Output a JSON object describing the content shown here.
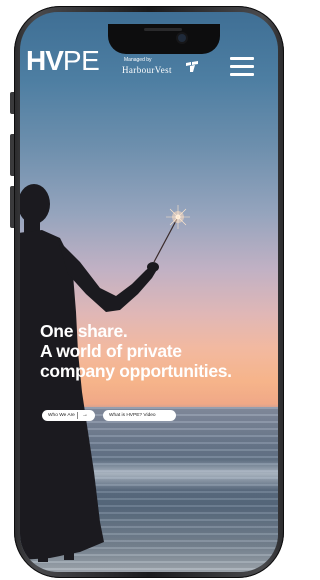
{
  "header": {
    "logo_hv": "HV",
    "logo_pe": "PE",
    "managed_by": "Managed by",
    "brand": "HarbourVest"
  },
  "hero": {
    "headline_lines": [
      "One share.",
      "A world of private",
      "company opportunities."
    ]
  },
  "actions": {
    "who_we_are": "Who We Are",
    "who_we_are_arrow": "→",
    "video": "What is HVPE? Video"
  },
  "icons": {
    "menu": "hamburger-menu-icon",
    "brand_mark": "harbourvest-flag-icon",
    "arrow": "arrow-right-icon"
  },
  "colors": {
    "text": "#ffffff",
    "button_bg": "#ffffff",
    "button_text": "#1a1a1a"
  }
}
